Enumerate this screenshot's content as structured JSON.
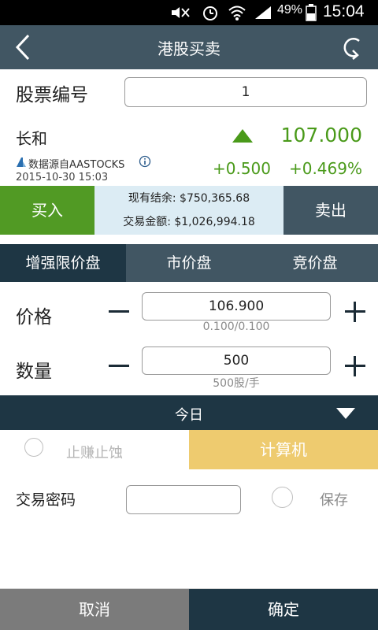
{
  "status_bar": {
    "battery": "49%",
    "time": "15:04"
  },
  "header": {
    "title": "港股买卖"
  },
  "stock": {
    "code_label": "股票编号",
    "code_value": "1",
    "name": "长和",
    "price": "107.000",
    "change": "+0.500",
    "change_pct": "+0.469%",
    "source": "数据源自AASTOCKS",
    "timestamp": "2015-10-30 15:03"
  },
  "trade_bar": {
    "buy": "买入",
    "sell": "卖出",
    "cash_balance": "现有结余: $750,365.68",
    "trade_amount": "交易金额: $1,026,994.18"
  },
  "order_tabs": [
    "增强限价盘",
    "市价盘",
    "竞价盘"
  ],
  "price_row": {
    "label": "价格",
    "value": "106.900",
    "hint": "0.100/0.100"
  },
  "qty_row": {
    "label": "数量",
    "value": "500",
    "hint": "500股/手"
  },
  "validity": {
    "label": "今日"
  },
  "options": {
    "stop_label": "止赚止蚀",
    "calculator": "计算机"
  },
  "password": {
    "label": "交易密码",
    "save_label": "保存"
  },
  "footer": {
    "cancel": "取消",
    "confirm": "确定"
  },
  "colors": {
    "header_bg": "#415663",
    "buy_green": "#519a24",
    "up_green": "#4a9a1a",
    "calculator_yellow": "#eecb6f",
    "info_bg": "#dcecf4",
    "cancel_grey": "#7b7b7b",
    "confirm_dark": "#1e3644"
  }
}
